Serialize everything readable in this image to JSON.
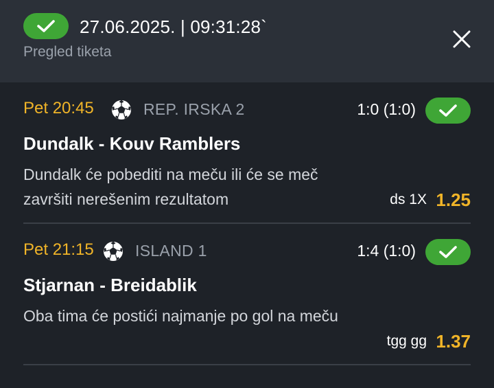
{
  "header": {
    "datetime": "27.06.2025. | 09:31:28`",
    "subtitle": "Pregled tiketa"
  },
  "icons": {
    "status": "check-icon",
    "close": "close-icon",
    "sport": "soccer-ball-icon"
  },
  "colors": {
    "accent_green": "#3fa636",
    "accent_orange": "#f0b428",
    "background": "#1e2228",
    "header_background": "#2b3038"
  },
  "bets": [
    {
      "time": "Pet 20:45",
      "league": "REP. IRSKA 2",
      "score": "1:0 (1:0)",
      "match": "Dundalk - Kouv Ramblers",
      "description": "Dundalk će pobediti na meču ili će se meč završiti nerešenim rezultatom",
      "bet_type": "ds 1X",
      "odd": "1.25"
    },
    {
      "time": "Pet 21:15",
      "league": "ISLAND 1",
      "score": "1:4 (1:0)",
      "match": "Stjarnan - Breidablik",
      "description": "Oba tima će postići najmanje po gol na meču",
      "bet_type": "tgg gg",
      "odd": "1.37"
    }
  ]
}
